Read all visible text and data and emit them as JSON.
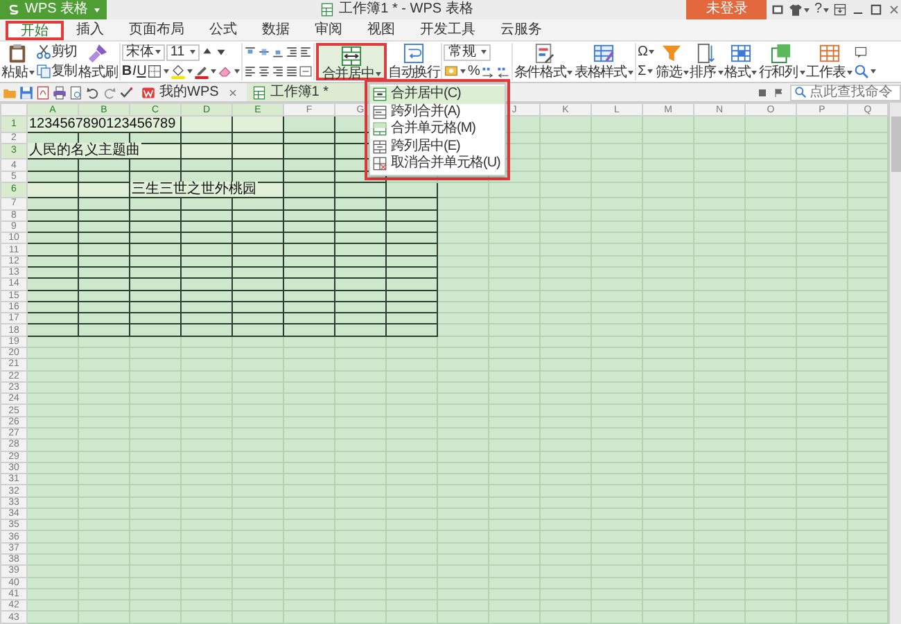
{
  "app_menu": {
    "label": "WPS 表格"
  },
  "window": {
    "title": "工作簿1 * - WPS 表格"
  },
  "login_button": {
    "label": "未登录"
  },
  "help_button": {
    "label": "?"
  },
  "ribbon_tabs": [
    {
      "label": "开始",
      "selected": true
    },
    {
      "label": "插入",
      "selected": false
    },
    {
      "label": "页面布局",
      "selected": false
    },
    {
      "label": "公式",
      "selected": false
    },
    {
      "label": "数据",
      "selected": false
    },
    {
      "label": "审阅",
      "selected": false
    },
    {
      "label": "视图",
      "selected": false
    },
    {
      "label": "开发工具",
      "selected": false
    },
    {
      "label": "云服务",
      "selected": false
    }
  ],
  "ribbon": {
    "paste": "粘贴",
    "cut": "剪切",
    "copy": "复制",
    "format_painter": "格式刷",
    "font_name": "宋体",
    "font_size": "11",
    "bold": "B",
    "italic": "I",
    "underline": "U",
    "merge_center": {
      "label": "合并居中",
      "expanded": true
    },
    "wrap_text": "自动换行",
    "number_format": "常规",
    "percent": "%",
    "conditional_format": "条件格式",
    "table_style": "表格样式",
    "symbol": "Ω",
    "sum": "Σ",
    "filter": "筛选",
    "sort": "排序",
    "format": "格式",
    "rows_columns": "行和列",
    "worksheet": "工作表"
  },
  "merge_menu": [
    {
      "label": "合并居中(C)",
      "selected": true
    },
    {
      "label": "跨列合并(A)",
      "selected": false
    },
    {
      "label": "合并单元格(M)",
      "selected": false
    },
    {
      "label": "跨列居中(E)",
      "selected": false
    },
    {
      "label": "取消合并单元格(U)",
      "selected": false
    }
  ],
  "doc_tabs": [
    {
      "label": "我的WPS",
      "selected": false
    },
    {
      "label": "工作簿1 *",
      "selected": true
    }
  ],
  "command_search": {
    "placeholder": "点此查找命令"
  },
  "sheet": {
    "columns": [
      {
        "label": "A",
        "selected": true
      },
      {
        "label": "B",
        "selected": true
      },
      {
        "label": "C",
        "selected": true
      },
      {
        "label": "D",
        "selected": true
      },
      {
        "label": "E",
        "selected": true
      },
      {
        "label": "F",
        "selected": false
      },
      {
        "label": "G",
        "selected": false
      },
      null,
      null,
      {
        "label": "J",
        "selected": false
      },
      {
        "label": "K",
        "selected": false
      },
      {
        "label": "L",
        "selected": false
      },
      {
        "label": "M",
        "selected": false
      },
      {
        "label": "N",
        "selected": false
      },
      {
        "label": "O",
        "selected": false
      },
      {
        "label": "P",
        "selected": false
      },
      {
        "label": "Q",
        "selected": false
      }
    ],
    "rows": [
      {
        "label": "1",
        "selected": true,
        "cells": [
          {
            "text": "1234567890123456789",
            "bordered": true
          },
          {
            "bordered": true
          },
          {
            "bordered": true
          },
          {
            "bordered": true
          },
          {
            "bordered": true
          },
          {
            "bordered": true
          },
          {
            "bordered": true
          },
          null
        ]
      },
      {
        "label": "2",
        "selected": false,
        "cells": [
          {
            "bordered": true
          },
          {
            "bordered": true
          },
          {
            "bordered": true
          },
          {
            "bordered": true
          },
          {
            "bordered": true
          },
          {
            "bordered": true
          },
          {
            "bordered": true
          },
          null
        ]
      },
      {
        "label": "3",
        "selected": true,
        "cells": [
          {
            "text": "人民的名义主题曲",
            "bordered": true
          },
          {
            "bordered": true
          },
          {
            "bordered": true
          },
          {
            "bordered": true
          },
          {
            "bordered": true
          },
          {
            "bordered": true
          },
          {
            "bordered": true
          },
          null
        ]
      },
      {
        "label": "4",
        "selected": false,
        "cells": [
          {
            "bordered": true
          },
          {
            "bordered": true
          },
          {
            "bordered": true
          },
          {
            "bordered": true
          },
          {
            "bordered": true
          },
          {
            "bordered": true
          },
          {
            "bordered": true
          },
          null
        ]
      },
      {
        "label": "5",
        "selected": false,
        "cells": [
          {
            "bordered": true
          },
          {
            "bordered": true
          },
          {
            "bordered": true
          },
          {
            "bordered": true
          },
          {
            "bordered": true
          },
          {
            "bordered": true
          },
          {
            "bordered": true
          },
          null
        ]
      },
      {
        "label": "6",
        "selected": true,
        "cells": [
          {
            "bordered": true
          },
          {
            "bordered": true
          },
          {
            "text": "三生三世之世外桃园",
            "bordered": true
          },
          {
            "bordered": true
          },
          {
            "bordered": true
          },
          {
            "bordered": true
          },
          {
            "bordered": true
          },
          {
            "bordered": true
          }
        ]
      },
      {
        "label": "7",
        "selected": false,
        "cells": [
          {
            "bordered": true
          },
          {
            "bordered": true
          },
          {
            "bordered": true
          },
          {
            "bordered": true
          },
          {
            "bordered": true
          },
          {
            "bordered": true
          },
          {
            "bordered": true
          },
          {
            "bordered": true
          }
        ]
      },
      {
        "label": "8",
        "selected": false,
        "cells": [
          {
            "bordered": true
          },
          {
            "bordered": true
          },
          {
            "bordered": true
          },
          {
            "bordered": true
          },
          {
            "bordered": true
          },
          {
            "bordered": true
          },
          {
            "bordered": true
          },
          {
            "bordered": true
          }
        ]
      },
      {
        "label": "9",
        "selected": false,
        "cells": [
          {
            "bordered": true
          },
          {
            "bordered": true
          },
          {
            "bordered": true
          },
          {
            "bordered": true
          },
          {
            "bordered": true
          },
          {
            "bordered": true
          },
          {
            "bordered": true
          },
          {
            "bordered": true
          }
        ]
      },
      {
        "label": "10",
        "selected": false,
        "cells": [
          {
            "bordered": true
          },
          {
            "bordered": true
          },
          {
            "bordered": true
          },
          {
            "bordered": true
          },
          {
            "bordered": true
          },
          {
            "bordered": true
          },
          {
            "bordered": true
          },
          {
            "bordered": true
          }
        ]
      },
      {
        "label": "11",
        "selected": false,
        "cells": [
          {
            "bordered": true
          },
          {
            "bordered": true
          },
          {
            "bordered": true
          },
          {
            "bordered": true
          },
          {
            "bordered": true
          },
          {
            "bordered": true
          },
          {
            "bordered": true
          },
          {
            "bordered": true
          }
        ]
      },
      {
        "label": "12",
        "selected": false,
        "cells": [
          {
            "bordered": true
          },
          {
            "bordered": true
          },
          {
            "bordered": true
          },
          {
            "bordered": true
          },
          {
            "bordered": true
          },
          {
            "bordered": true
          },
          {
            "bordered": true
          },
          {
            "bordered": true
          }
        ]
      },
      {
        "label": "13",
        "selected": false,
        "cells": [
          {
            "bordered": true
          },
          {
            "bordered": true
          },
          {
            "bordered": true
          },
          {
            "bordered": true
          },
          {
            "bordered": true
          },
          {
            "bordered": true
          },
          {
            "bordered": true
          },
          {
            "bordered": true
          }
        ]
      },
      {
        "label": "14",
        "selected": false,
        "cells": [
          {
            "bordered": true
          },
          {
            "bordered": true
          },
          {
            "bordered": true
          },
          {
            "bordered": true
          },
          {
            "bordered": true
          },
          {
            "bordered": true
          },
          {
            "bordered": true
          },
          {
            "bordered": true
          }
        ]
      },
      {
        "label": "15",
        "selected": false,
        "cells": [
          {
            "bordered": true
          },
          {
            "bordered": true
          },
          {
            "bordered": true
          },
          {
            "bordered": true
          },
          {
            "bordered": true
          },
          {
            "bordered": true
          },
          {
            "bordered": true
          },
          {
            "bordered": true
          }
        ]
      },
      {
        "label": "16",
        "selected": false,
        "cells": [
          {
            "bordered": true
          },
          {
            "bordered": true
          },
          {
            "bordered": true
          },
          {
            "bordered": true
          },
          {
            "bordered": true
          },
          {
            "bordered": true
          },
          {
            "bordered": true
          },
          {
            "bordered": true
          }
        ]
      },
      {
        "label": "17",
        "selected": false,
        "cells": [
          {
            "bordered": true
          },
          {
            "bordered": true
          },
          {
            "bordered": true
          },
          {
            "bordered": true
          },
          {
            "bordered": true
          },
          {
            "bordered": true
          },
          {
            "bordered": true
          },
          {
            "bordered": true
          }
        ]
      },
      {
        "label": "18",
        "selected": false,
        "cells": [
          {
            "bordered": true
          },
          {
            "bordered": true
          },
          {
            "bordered": true
          },
          {
            "bordered": true
          },
          {
            "bordered": true
          },
          {
            "bordered": true
          },
          {
            "bordered": true
          },
          {
            "bordered": true
          }
        ]
      },
      {
        "label": "19",
        "selected": false
      },
      {
        "label": "20",
        "selected": false
      },
      {
        "label": "21",
        "selected": false
      },
      {
        "label": "22",
        "selected": false
      },
      {
        "label": "23",
        "selected": false
      },
      {
        "label": "24",
        "selected": false
      },
      {
        "label": "25",
        "selected": false
      },
      {
        "label": "26",
        "selected": false
      },
      {
        "label": "27",
        "selected": false
      },
      {
        "label": "28",
        "selected": false
      },
      {
        "label": "29",
        "selected": false
      },
      {
        "label": "30",
        "selected": false
      },
      {
        "label": "31",
        "selected": false
      },
      {
        "label": "32",
        "selected": false
      },
      {
        "label": "33",
        "selected": false
      },
      {
        "label": "34",
        "selected": false
      },
      {
        "label": "35",
        "selected": false
      },
      {
        "label": "36",
        "selected": false
      },
      {
        "label": "37",
        "selected": false
      },
      {
        "label": "38",
        "selected": false
      },
      {
        "label": "39",
        "selected": false
      },
      {
        "label": "40",
        "selected": false
      },
      {
        "label": "41",
        "selected": false
      },
      {
        "label": "42",
        "selected": false
      },
      {
        "label": "43",
        "selected": false
      }
    ]
  }
}
